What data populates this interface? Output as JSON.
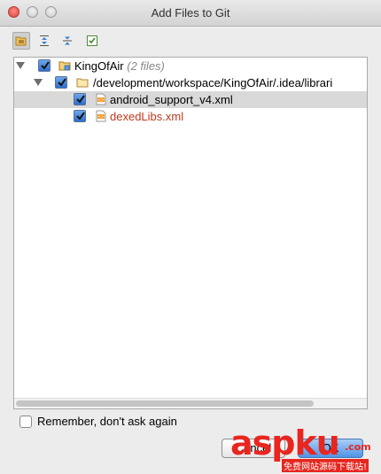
{
  "window": {
    "title": "Add Files to Git"
  },
  "toolbar": {
    "buttons": [
      {
        "icon": "group-by-directory-icon",
        "active": true
      },
      {
        "icon": "expand-all-icon",
        "active": false
      },
      {
        "icon": "collapse-all-icon",
        "active": false
      },
      {
        "icon": "select-all-icon",
        "active": false
      }
    ]
  },
  "tree": {
    "root": {
      "label": "KingOfAir",
      "count": "(2 files)",
      "checked": true
    },
    "folder": {
      "label": "/development/workspace/KingOfAir/.idea/librari",
      "checked": true
    },
    "files": [
      {
        "label": "android_support_v4.xml",
        "checked": true,
        "selected": true,
        "color": "#000000"
      },
      {
        "label": "dexedLibs.xml",
        "checked": true,
        "selected": false,
        "color": "#c0391d"
      }
    ]
  },
  "remember": {
    "label": "Remember, don't ask again",
    "checked": false
  },
  "buttons": {
    "cancel": "Cancel",
    "ok": "OK"
  },
  "watermark": {
    "main": "aspku",
    "suffix": ".com",
    "sub": "免费网站源码下载站!"
  },
  "colors": {
    "accent": "#2c6fd1",
    "untracked_file": "#c0391d",
    "watermark": "#e8261f"
  }
}
